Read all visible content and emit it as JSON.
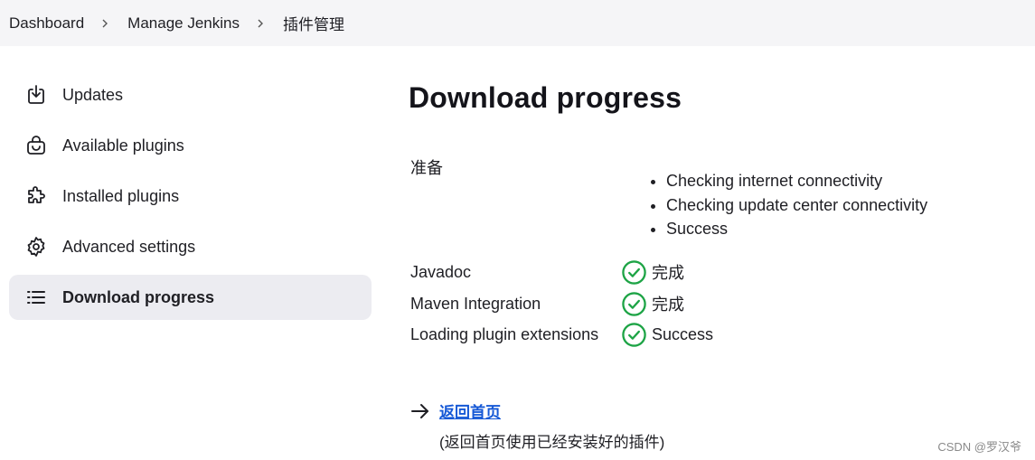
{
  "breadcrumb": {
    "items": [
      "Dashboard",
      "Manage Jenkins",
      "插件管理"
    ]
  },
  "sidebar": {
    "items": [
      {
        "label": "Updates",
        "icon": "download-icon",
        "active": false
      },
      {
        "label": "Available plugins",
        "icon": "shopping-bag-icon",
        "active": false
      },
      {
        "label": "Installed plugins",
        "icon": "puzzle-icon",
        "active": false
      },
      {
        "label": "Advanced settings",
        "icon": "gear-icon",
        "active": false
      },
      {
        "label": "Download progress",
        "icon": "list-icon",
        "active": true
      }
    ]
  },
  "main": {
    "title": "Download progress",
    "preparation": {
      "label": "准备",
      "steps": [
        "Checking internet connectivity",
        "Checking update center connectivity",
        "Success"
      ]
    },
    "jobs": [
      {
        "name": "Javadoc",
        "status": "完成",
        "icon": "check-circle-icon"
      },
      {
        "name": "Maven Integration",
        "status": "完成",
        "icon": "check-circle-icon"
      },
      {
        "name": "Loading plugin extensions",
        "status": "Success",
        "icon": "check-circle-icon"
      }
    ],
    "back": {
      "link": "返回首页",
      "note": "(返回首页使用已经安装好的插件)",
      "icon": "arrow-right-icon"
    }
  },
  "colors": {
    "accent_link": "#1558d6",
    "success": "#1ea446",
    "active_bg": "#ececf1",
    "breadcrumb_bg": "#f5f5f7"
  },
  "watermark": "CSDN @罗汉爷"
}
